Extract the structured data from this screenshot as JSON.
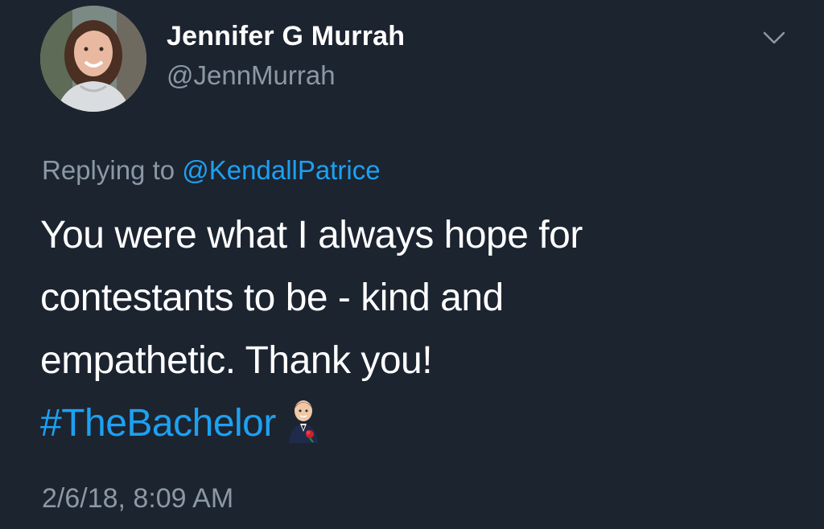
{
  "author": {
    "display_name": "Jennifer G Murrah",
    "handle": "@JennMurrah"
  },
  "menu": {
    "icon": "chevron-down-icon"
  },
  "reply": {
    "prefix": "Replying to",
    "mention": "@KendallPatrice"
  },
  "tweet": {
    "lines": [
      "You were what I always hope for",
      "contestants to be - kind and",
      "empathetic. Thank you!"
    ],
    "hashtag": "#TheBachelor",
    "emoji": "man-with-rose-emoji",
    "timestamp": "2/6/18, 8:09 AM"
  },
  "colors": {
    "background": "#1c2430",
    "primary_text": "#ffffff",
    "secondary_text": "#8b98a5",
    "accent": "#1da1f2"
  }
}
